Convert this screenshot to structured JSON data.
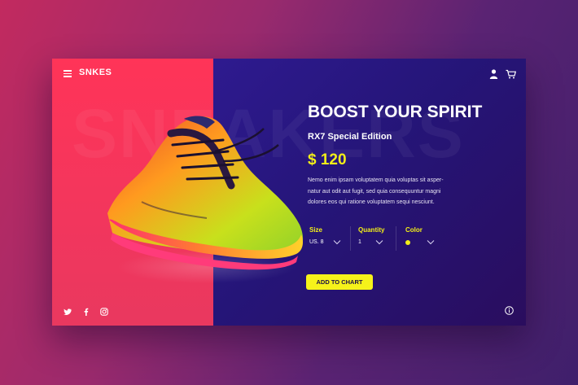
{
  "header": {
    "logo": "SNKES"
  },
  "background_word": "SNEAKERS",
  "product": {
    "headline": "BOOST YOUR SPIRIT",
    "edition": "RX7 Special Edition",
    "price": "$ 120",
    "description": "Nemo enim ipsam voluptatem quia voluptas sit asper-natur aut odit aut fugit, sed quia consequuntur magni dolores eos qui ratione voluptatem sequi nesciunt."
  },
  "options": {
    "size_label": "Size",
    "size_value": "US. 8",
    "quantity_label": "Quantity",
    "quantity_value": "1",
    "color_label": "Color",
    "color_value": "#f2ee18"
  },
  "cta": {
    "add_to_cart": "ADD TO CHART"
  },
  "colors": {
    "accent": "#f2ee18",
    "left_panel": "#f2365d",
    "right_panel": "#251578"
  },
  "icons": {
    "menu": "menu-icon",
    "user": "user-icon",
    "cart": "cart-icon",
    "twitter": "twitter-icon",
    "facebook": "facebook-icon",
    "instagram": "instagram-icon",
    "info": "info-icon"
  }
}
